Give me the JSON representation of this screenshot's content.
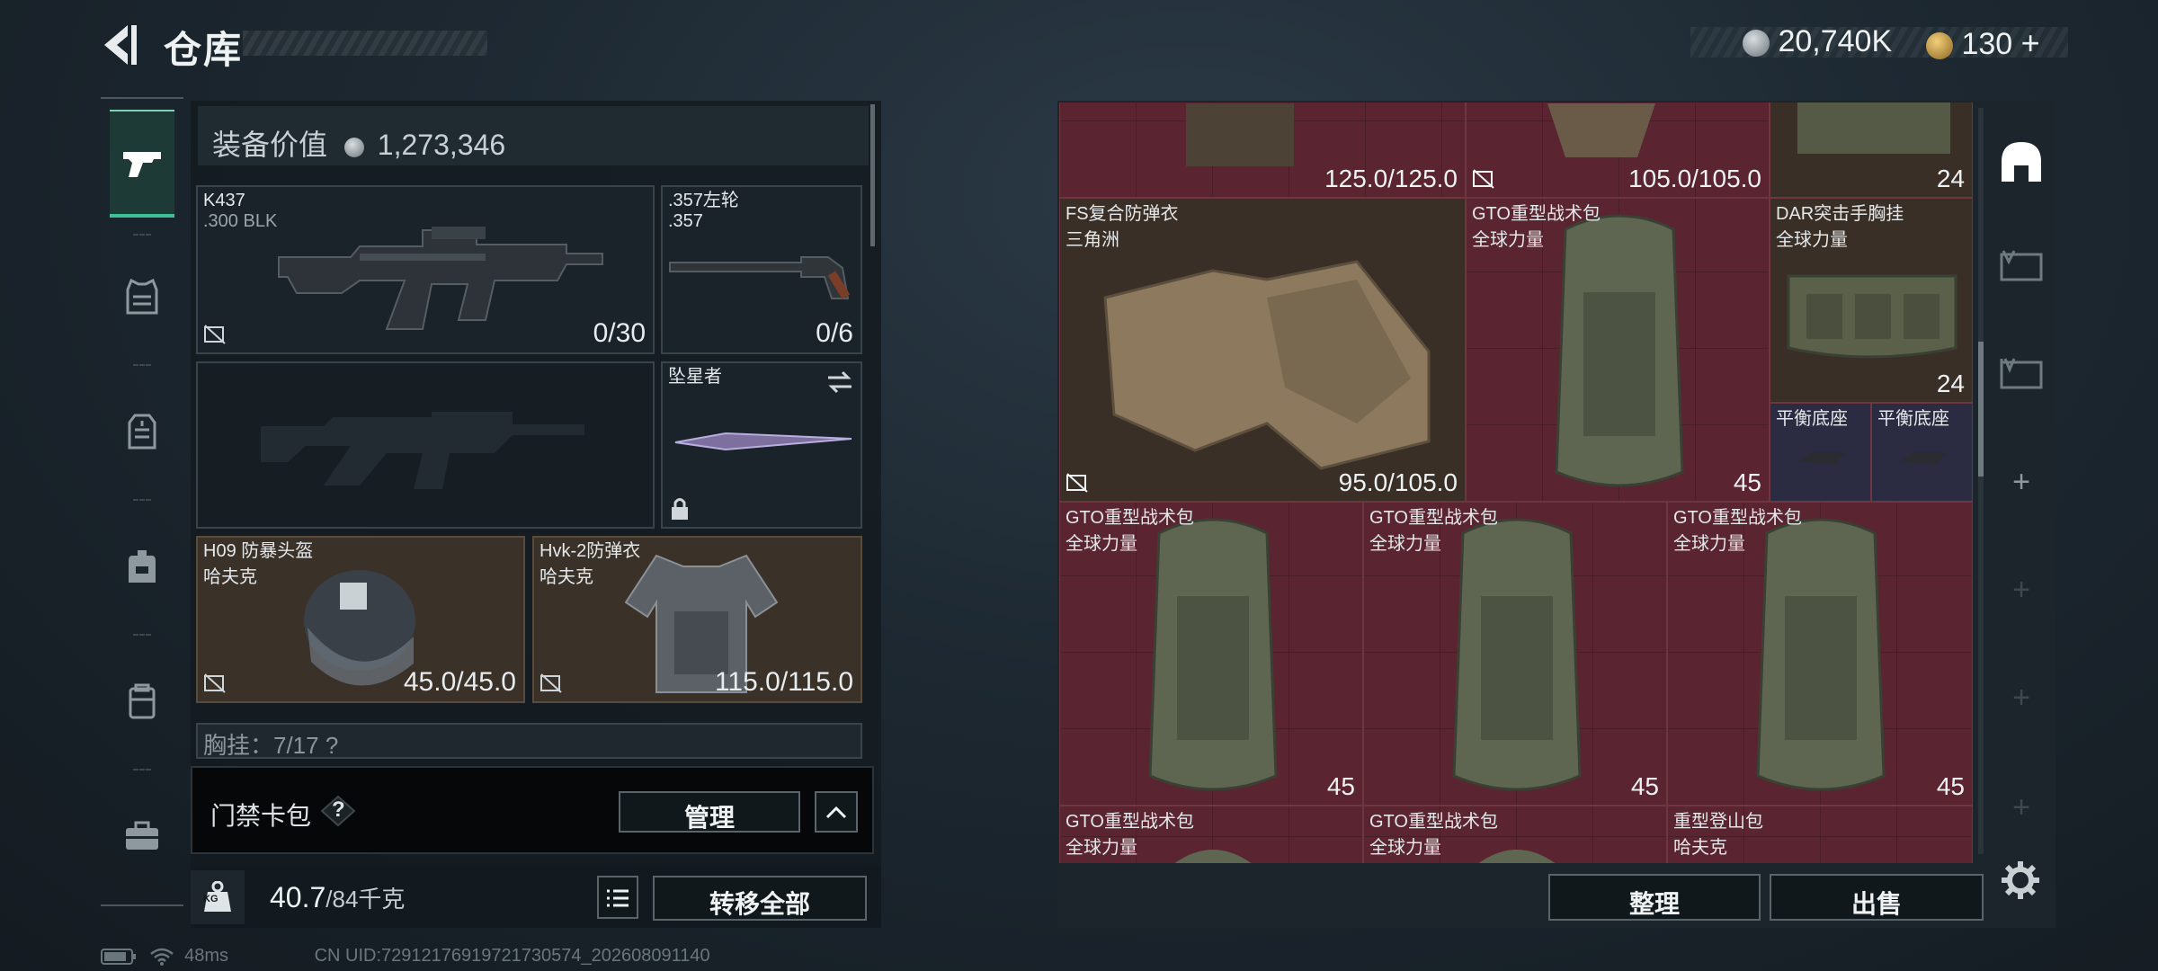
{
  "header": {
    "title": "仓库",
    "currency_silver": "20,740K",
    "currency_gold": "130",
    "gold_plus": "+"
  },
  "nav": {
    "items": [
      {
        "name": "weapons",
        "icon": "pistol-icon",
        "active": true
      },
      {
        "name": "armor",
        "icon": "vest-icon"
      },
      {
        "name": "chest-rig",
        "icon": "rig-icon"
      },
      {
        "name": "backpack",
        "icon": "backpack-icon"
      },
      {
        "name": "pouch",
        "icon": "pouch-icon"
      },
      {
        "name": "case",
        "icon": "briefcase-icon"
      }
    ]
  },
  "loadout": {
    "value_label": "装备价值",
    "value": "1,273,346",
    "primary": {
      "name": "K437",
      "ammo": ".300 BLK",
      "count": "0/30"
    },
    "secondary": {
      "name": ".357左轮",
      "ammo": ".357",
      "count": "0/6"
    },
    "empty_slot": "",
    "melee": {
      "name": "坠星者"
    },
    "helmet": {
      "name": "H09 防暴头盔",
      "brand": "哈夫克",
      "durability": "45.0/45.0"
    },
    "armor": {
      "name": "Hvk-2防弹衣",
      "brand": "哈夫克",
      "durability": "115.0/115.0"
    },
    "chest_rig_partial": "胸挂：7/17 ?"
  },
  "keycard": {
    "label": "门禁卡包",
    "help": "?",
    "manage": "管理"
  },
  "weight": {
    "current": "40.7",
    "max": "/84千克",
    "kg": "KG"
  },
  "actions": {
    "transfer_all": "转移全部",
    "sort": "整理",
    "sell": "出售"
  },
  "stash": {
    "top_row": [
      {
        "value": "125.0/125.0"
      },
      {
        "value": "105.0/105.0"
      },
      {
        "value": "24"
      }
    ],
    "items": [
      {
        "name": "FS复合防弹衣",
        "brand": "三角洲",
        "value": "95.0/105.0"
      },
      {
        "name": "GTO重型战术包",
        "brand": "全球力量",
        "value": "45"
      },
      {
        "name": "DAR突击手胸挂",
        "brand": "全球力量",
        "value": "24"
      },
      {
        "name": "平衡底座",
        "brand": ""
      },
      {
        "name": "平衡底座",
        "brand": ""
      },
      {
        "name": "GTO重型战术包",
        "brand": "全球力量",
        "value": "45"
      },
      {
        "name": "GTO重型战术包",
        "brand": "全球力量",
        "value": "45"
      },
      {
        "name": "GTO重型战术包",
        "brand": "全球力量",
        "value": "45"
      },
      {
        "name": "GTO重型战术包",
        "brand": "全球力量"
      },
      {
        "name": "GTO重型战术包",
        "brand": "全球力量"
      },
      {
        "name": "重型登山包",
        "brand": "哈夫克"
      }
    ]
  },
  "side_tabs": [
    "home",
    "stash-V",
    "stash-IV",
    "+",
    "+",
    "+",
    "+"
  ],
  "status": {
    "ping": "48ms",
    "uid": "CN UID:72912176919721730574_202608091140"
  },
  "colors": {
    "accent": "#3fbf94",
    "cell_red": "#5a2530",
    "cell_tan": "#3a2f27"
  }
}
